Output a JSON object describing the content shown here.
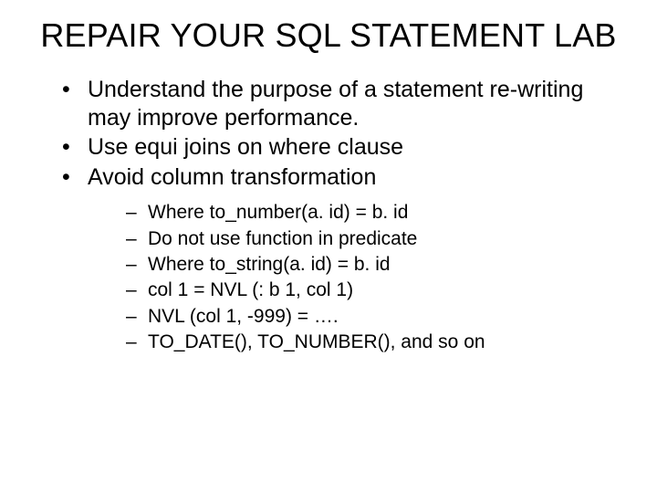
{
  "title": "REPAIR YOUR SQL STATEMENT LAB",
  "bullets": {
    "b0": "Understand the purpose of a statement re-writing may improve performance.",
    "b1": "Use equi joins on where clause",
    "b2": "Avoid column transformation"
  },
  "subbullets": {
    "s0": "Where to_number(a. id) = b. id",
    "s1": "Do not use function in predicate",
    "s2": "Where to_string(a. id) = b. id",
    "s3": "col 1 = NVL (: b 1, col 1)",
    "s4": "NVL (col 1, -999) = ….",
    "s5": "TO_DATE(), TO_NUMBER(), and so on"
  }
}
